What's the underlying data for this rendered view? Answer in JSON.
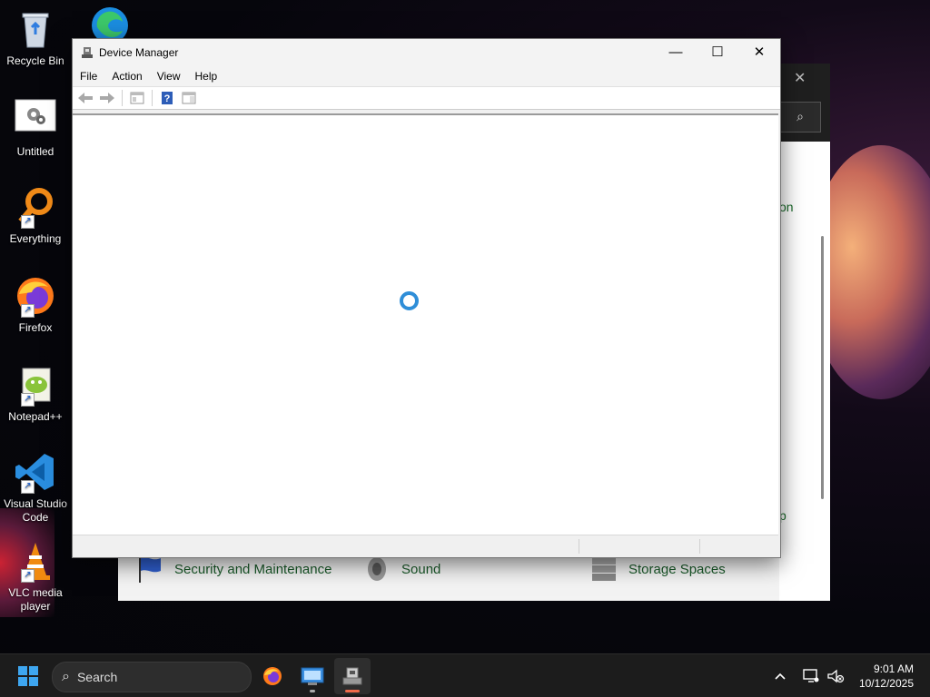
{
  "desktop": {
    "icons": [
      {
        "label": "Recycle Bin"
      },
      {
        "label": "Untitled"
      },
      {
        "label": "Everything"
      },
      {
        "label": "Firefox"
      },
      {
        "label": "Notepad++"
      },
      {
        "label": "Visual Studio Code"
      },
      {
        "label": "VLC media player"
      }
    ]
  },
  "control_panel": {
    "partial_link_1": "on",
    "partial_link_2": "p",
    "items": [
      {
        "label": "Security and Maintenance",
        "icon": "flag-icon"
      },
      {
        "label": "Sound",
        "icon": "speaker-icon"
      },
      {
        "label": "Storage Spaces",
        "icon": "storage-icon"
      }
    ]
  },
  "device_manager": {
    "title": "Device Manager",
    "menu": [
      "File",
      "Action",
      "View",
      "Help"
    ],
    "toolbar": [
      "back-icon",
      "forward-icon",
      "properties-view-icon",
      "help-icon",
      "console-tree-icon"
    ],
    "status": "loading"
  },
  "taskbar": {
    "search_placeholder": "Search",
    "clock_time": "9:01 AM",
    "clock_date": "10/12/2025",
    "accent": "#3ea6f0"
  }
}
